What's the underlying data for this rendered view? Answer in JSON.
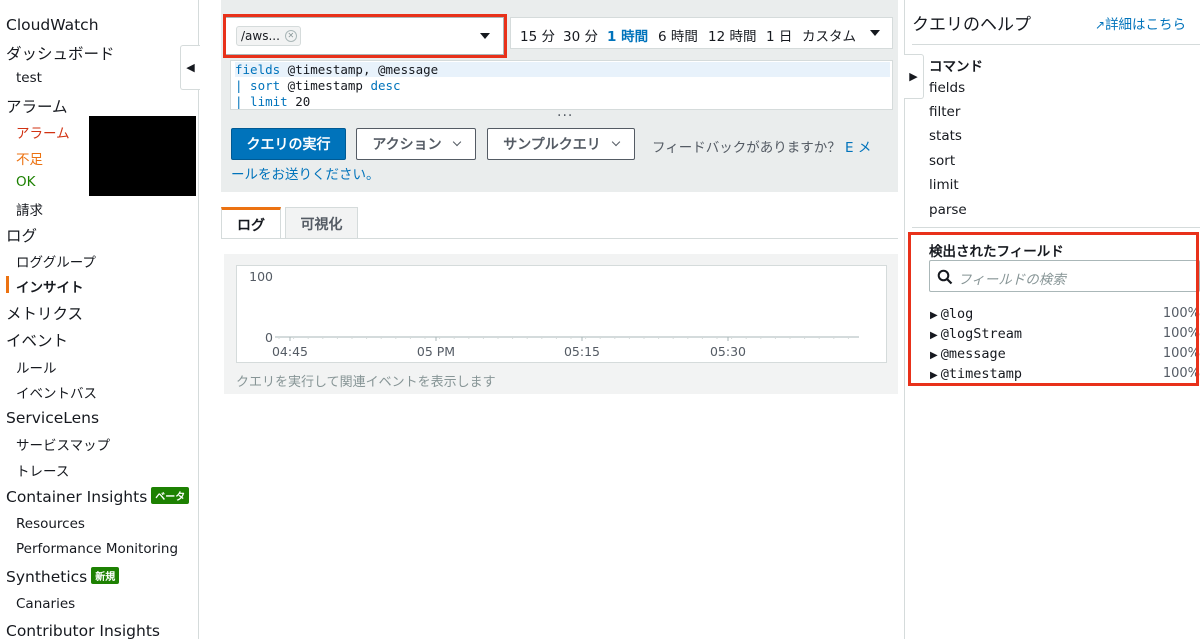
{
  "sidebar": {
    "items": [
      {
        "label": "CloudWatch"
      },
      {
        "label": "ダッシュボード"
      },
      {
        "label": "test"
      },
      {
        "label": "アラーム"
      },
      {
        "label": "アラーム"
      },
      {
        "label": "不足"
      },
      {
        "label": "OK"
      },
      {
        "label": "請求"
      },
      {
        "label": "ログ"
      },
      {
        "label": "ロググループ"
      },
      {
        "label": "インサイト"
      },
      {
        "label": "メトリクス"
      },
      {
        "label": "イベント"
      },
      {
        "label": "ルール"
      },
      {
        "label": "イベントバス"
      },
      {
        "label": "ServiceLens"
      },
      {
        "label": "サービスマップ"
      },
      {
        "label": "トレース"
      },
      {
        "label": "Container Insights",
        "badge": "ベータ"
      },
      {
        "label": "Resources"
      },
      {
        "label": "Performance Monitoring"
      },
      {
        "label": "Synthetics",
        "badge": "新規"
      },
      {
        "label": "Canaries"
      },
      {
        "label": "Contributor Insights"
      }
    ]
  },
  "query": {
    "log_group_token": "/aws...",
    "time_range": {
      "options": [
        "15 分",
        "30 分",
        "1 時間",
        "6 時間",
        "12 時間",
        "1 日",
        "カスタム"
      ],
      "selected": "1 時間"
    },
    "editor_lines": [
      {
        "kw": "fields",
        "rest": " @timestamp, @message"
      },
      {
        "kw": "| sort",
        "rest": " @timestamp ",
        "kw2": "desc"
      },
      {
        "kw": "| limit",
        "rest": " 20"
      }
    ],
    "run_button": "クエリの実行",
    "actions_button": "アクション",
    "sample_button": "サンプルクエリ",
    "feedback_text": "フィードバックがありますか？",
    "feedback_link_1": "E メ",
    "feedback_link_2": "ールをお送りください。"
  },
  "tabs": [
    "ログ",
    "可視化"
  ],
  "chart_data": {
    "type": "line",
    "x_ticks": [
      "04:45",
      "05 PM",
      "05:15",
      "05:30"
    ],
    "y_ticks": [
      "100",
      "0"
    ],
    "ylim": [
      0,
      100
    ],
    "series": [],
    "hint": "クエリを実行して関連イベントを表示します"
  },
  "help": {
    "title": "クエリのヘルプ",
    "link": "詳細はこちら",
    "commands_header": "コマンド",
    "commands": [
      "fields",
      "filter",
      "stats",
      "sort",
      "limit",
      "parse"
    ],
    "fields_header": "検出されたフィールド",
    "search_placeholder": "フィールドの検索",
    "fields": [
      {
        "name": "@log",
        "pct": "100%"
      },
      {
        "name": "@logStream",
        "pct": "100%"
      },
      {
        "name": "@message",
        "pct": "100%"
      },
      {
        "name": "@timestamp",
        "pct": "100%"
      }
    ]
  },
  "colors": {
    "accent": "#0073bb",
    "active_bar": "#ec7211",
    "highlight": "#e8311a",
    "badge": "#1d8102"
  }
}
